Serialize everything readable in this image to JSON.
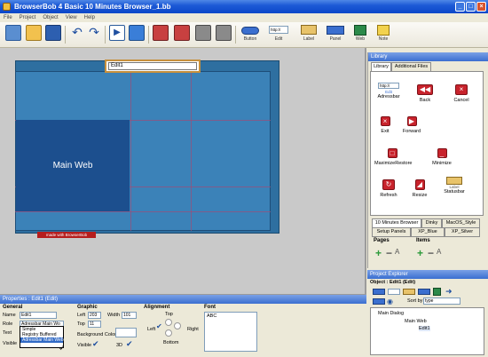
{
  "window": {
    "title": "BrowserBob 4 Basic   10 Minutes Browser_1.bb"
  },
  "menu": [
    "File",
    "Project",
    "Object",
    "View",
    "Help"
  ],
  "toolbar": {
    "labels": [
      "Button",
      "Edit",
      "Label",
      "Panel",
      "Web",
      "Note"
    ],
    "edit_combo": "http://"
  },
  "canvas": {
    "edit_value": "Edit1",
    "main_web_label": "Main Web",
    "made_with": "made with BrowserBob"
  },
  "library": {
    "title": "Library",
    "tabs": [
      "Library",
      "Additional Files"
    ],
    "adressbar_combo": "http://",
    "adressbar_sub": "Edit",
    "items": [
      "Adressbar",
      "Back",
      "Cancel",
      "Exit",
      "Forward",
      "MaximizeRestore",
      "Minimize",
      "Refresh",
      "Resize",
      "Statusbar"
    ],
    "statusbar_sub": "Label",
    "bottom_tabs_row1": [
      "10 Minutes Browser",
      "Dinky",
      "MacOS_Style"
    ],
    "bottom_tabs_row2": [
      "Setup Panels",
      "XP_Blue",
      "XP_Silver"
    ],
    "pages_label": "Pages",
    "items_label": "Items"
  },
  "project_explorer": {
    "title": "Project Explorer",
    "object_label": "Object : Edit1 (Edit)",
    "sort_label": "Sort by",
    "sort_value": "type",
    "tree": [
      "Main Dialog",
      "Main Web",
      "Edit1"
    ]
  },
  "properties": {
    "title": "Properties : Edit1 (Edit)",
    "general": "General",
    "name_label": "Name",
    "name_value": "Edit1",
    "role_label": "Role",
    "role_value": "Adressbar Main Wo",
    "text_label": "Text",
    "visible_label": "Visible",
    "role_options": [
      "Simple",
      "Registry Buffered",
      "Adressbar Main Web"
    ],
    "graphic": "Graphic",
    "left_label": "Left",
    "left_value": "203",
    "width_label": "Width",
    "width_value": "101",
    "top_label": "Top",
    "top_value": "11",
    "bgcolor_label": "Background Color",
    "visible2_label": "Visible",
    "threed_label": "3D",
    "alignment": "Alignment",
    "align_top": "Top",
    "align_left": "Left",
    "align_right": "Right",
    "align_bottom": "Bottom",
    "font": "Font",
    "font_value": "ABC"
  },
  "colors": {
    "title_bar": "#1d5ad6",
    "canvas_panel": "#3b82b8",
    "main_web": "#1c4f8e",
    "library_icon": "#c8232c"
  }
}
